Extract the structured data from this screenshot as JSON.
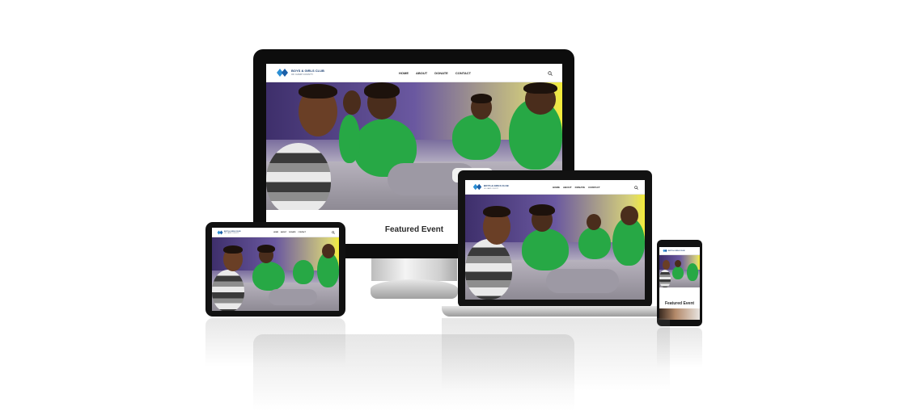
{
  "site": {
    "logo_title": "BOYS & GIRLS CLUB",
    "logo_subtitle": "OF CAMP COUNTY",
    "nav": [
      "HOME",
      "ABOUT",
      "DONATE",
      "CONTACT"
    ],
    "featured_heading": "Featured Event"
  },
  "icons": {
    "search": "search-icon",
    "logo": "club-logo-icon"
  },
  "colors": {
    "accent_green": "#27a845",
    "logo_blue": "#2c8fd4",
    "device_black": "#111111"
  }
}
